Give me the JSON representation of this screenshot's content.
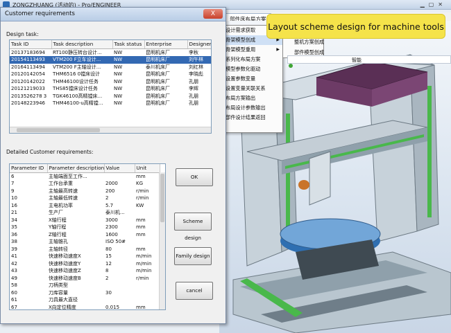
{
  "app": {
    "title": "ZONGZHUANG (活动的) - Pro/ENGINEER"
  },
  "proe": {
    "tab": "部件床布局方案",
    "input_value": "智能"
  },
  "menu": {
    "items": [
      {
        "label": "设计需求获取",
        "arrow": false
      },
      {
        "label": "骨架模型创成",
        "arrow": true
      },
      {
        "label": "骨架模型重用",
        "arrow": true
      },
      {
        "label": "系列化布局方案",
        "arrow": false
      },
      {
        "label": "模型参数化驱动",
        "arrow": false
      },
      {
        "label": "设置参数变量",
        "arrow": false
      },
      {
        "label": "设置变量关联关系",
        "arrow": false
      },
      {
        "label": "布局方案输出",
        "arrow": false
      },
      {
        "label": "布局设计参数输出",
        "arrow": false
      },
      {
        "label": "部件设计结果返回",
        "arrow": false
      }
    ],
    "submenu": [
      "整机方案创成",
      "部件模型创成"
    ]
  },
  "callout": "Layout scheme design for machine tools",
  "dialog": {
    "title": "Customer requirements",
    "close_label": "X",
    "design_task_label": "Design task:",
    "task_columns": [
      "Task ID",
      "Task description",
      "Task status",
      "Enterprise",
      "Designer"
    ],
    "tasks": [
      {
        "id": "20137183694",
        "desc": "RT100静压转台设计...",
        "status": "NW",
        "ent": "昆明机床厂",
        "designer": "李秋",
        "sel": false
      },
      {
        "id": "20154113493",
        "desc": "VTM200 F立车设计...",
        "status": "NW",
        "ent": "昆明机床厂",
        "designer": "刘午林",
        "sel": true
      },
      {
        "id": "20164113494",
        "desc": "VTM200 F主轴设计...",
        "status": "NW",
        "ent": "泰川机床厂",
        "designer": "刘红林",
        "sel": false
      },
      {
        "id": "20120142054",
        "desc": "THM6516 0镗床设计",
        "status": "NW",
        "ent": "昆明机床厂",
        "designer": "李晓彪",
        "sel": false
      },
      {
        "id": "20120142022",
        "desc": "THM46100设计任务",
        "status": "NW",
        "ent": "昆明机床厂",
        "designer": "孔朋",
        "sel": false
      },
      {
        "id": "20121219033",
        "desc": "THS85镗床设计任务",
        "status": "NW",
        "ent": "昆明机床厂",
        "designer": "李辉",
        "sel": false
      },
      {
        "id": "2013526278 3",
        "desc": "TGK46100高精镗床...",
        "status": "NW",
        "ent": "昆明机床厂",
        "designer": "孔朋",
        "sel": false
      },
      {
        "id": "20148223946",
        "desc": "THM46100-u高精镗...",
        "status": "NW",
        "ent": "昆明机床厂",
        "designer": "孔朋",
        "sel": false
      }
    ],
    "detail_label": "Detailed Customer requirements:",
    "param_columns": [
      "Parameter ID",
      "Parameter description",
      "Value",
      "Unit"
    ],
    "params": [
      {
        "id": "6",
        "desc": "主轴端面至工作...",
        "value": "",
        "unit": "mm"
      },
      {
        "id": "7",
        "desc": "工作台承重",
        "value": "2000",
        "unit": "KG"
      },
      {
        "id": "9",
        "desc": "主轴最高转速",
        "value": "200",
        "unit": "r/min"
      },
      {
        "id": "10",
        "desc": "主轴最低转速",
        "value": "2",
        "unit": "r/min"
      },
      {
        "id": "16",
        "desc": "主电机功率",
        "value": "5.7",
        "unit": "KW"
      },
      {
        "id": "21",
        "desc": "生产厂",
        "value": "泰川机...",
        "unit": ""
      },
      {
        "id": "34",
        "desc": "X轴行程",
        "value": "3000",
        "unit": "mm"
      },
      {
        "id": "35",
        "desc": "Y轴行程",
        "value": "2300",
        "unit": "mm"
      },
      {
        "id": "36",
        "desc": "Z轴行程",
        "value": "1600",
        "unit": "mm"
      },
      {
        "id": "38",
        "desc": "主轴锥孔",
        "value": "ISO 50#",
        "unit": ""
      },
      {
        "id": "39",
        "desc": "主轴转径",
        "value": "80",
        "unit": "mm"
      },
      {
        "id": "41",
        "desc": "快速移动速度X",
        "value": "15",
        "unit": "m/min"
      },
      {
        "id": "42",
        "desc": "快速移动速度Y",
        "value": "12",
        "unit": "m/min"
      },
      {
        "id": "43",
        "desc": "快速移动速度Z",
        "value": "8",
        "unit": "m/min"
      },
      {
        "id": "49",
        "desc": "快速移动速度B",
        "value": "2",
        "unit": "r/min"
      },
      {
        "id": "58",
        "desc": "刀柄类型",
        "value": "",
        "unit": ""
      },
      {
        "id": "60",
        "desc": "刀库容量",
        "value": "30",
        "unit": ""
      },
      {
        "id": "61",
        "desc": "刀具最大直径",
        "value": "",
        "unit": ""
      },
      {
        "id": "67",
        "desc": "X向定位精度",
        "value": "0.015",
        "unit": "mm"
      }
    ],
    "buttons": {
      "ok": "OK",
      "scheme": "Scheme design",
      "family": "Family design",
      "cancel": "cancel"
    }
  }
}
